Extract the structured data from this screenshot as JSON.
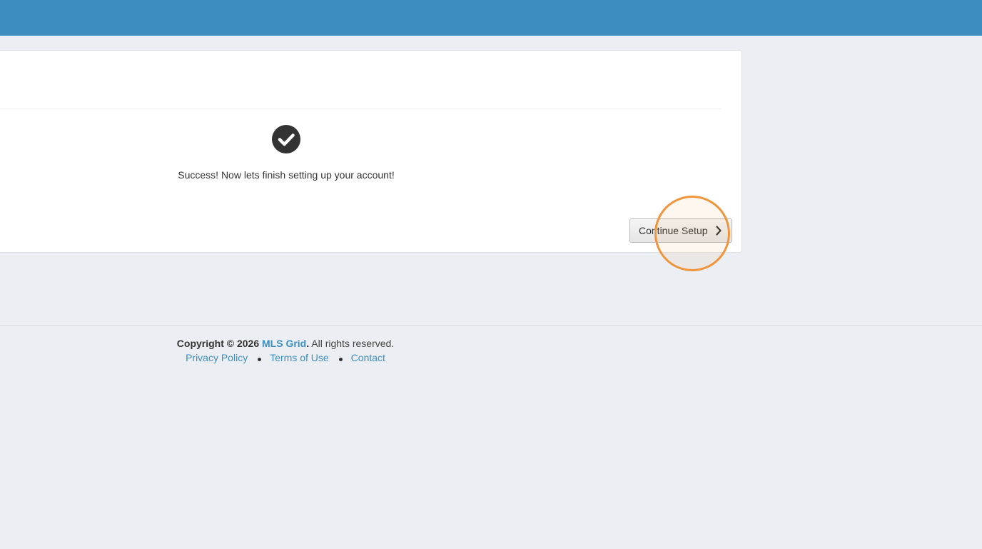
{
  "colors": {
    "topbar": "#3d8ebf",
    "background": "#ebeef2",
    "link": "#3d8ebf",
    "highlight": "#f0953c"
  },
  "panel": {
    "success_icon": "check-circle-icon",
    "success_message": "Success! Now lets finish setting up your account!",
    "continue_label": "Continue Setup",
    "continue_icon": "chevron-right-icon"
  },
  "footer": {
    "copyright_prefix": "Copyright © 2026",
    "brand": "MLS Grid",
    "period": ".",
    "rights": "All rights reserved.",
    "links": [
      "Privacy Policy",
      "Terms of Use",
      "Contact"
    ]
  }
}
